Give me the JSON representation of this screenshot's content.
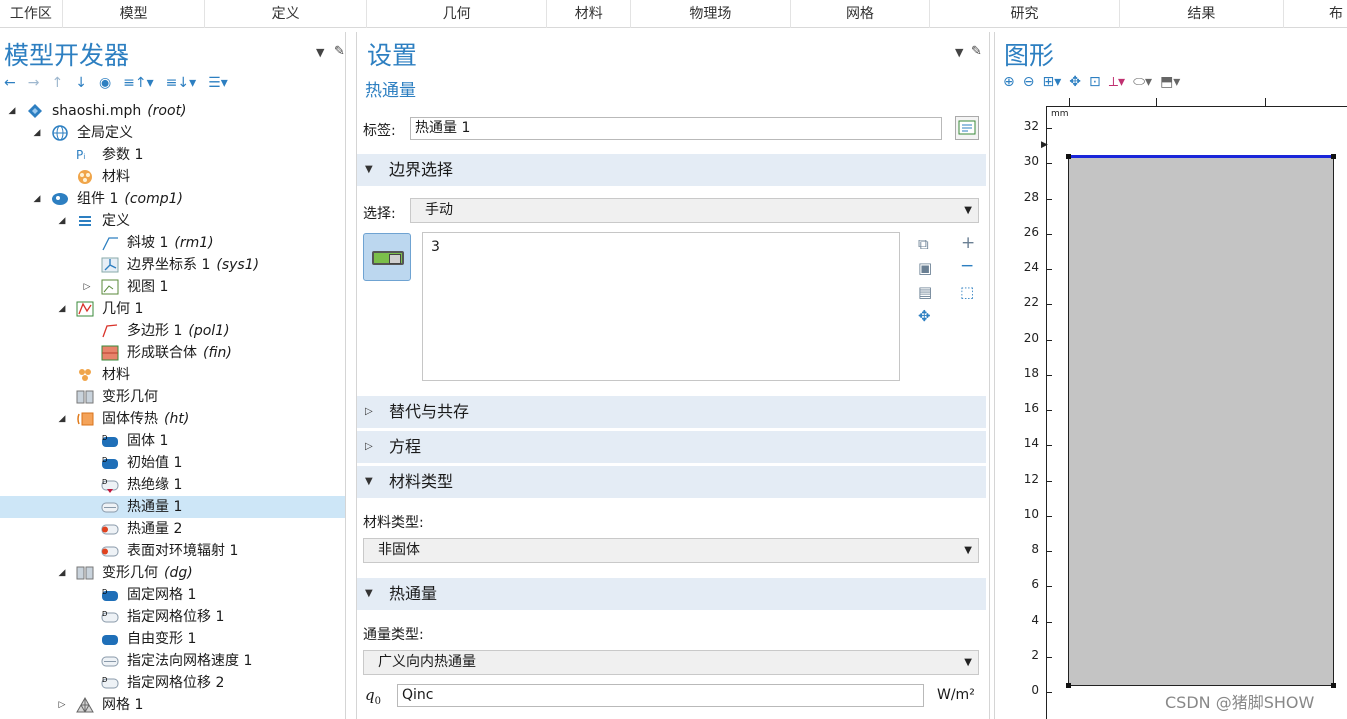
{
  "ribbon": {
    "tabs": [
      "工作区",
      "模型",
      "定义",
      "几何",
      "材料",
      "物理场",
      "网格",
      "研究",
      "结果",
      "布"
    ]
  },
  "left": {
    "title": "模型开发器",
    "toolbar": [
      "←",
      "→",
      "↑",
      "↓",
      "◉",
      "≡↑▾",
      "≡↓▾",
      "☰▾"
    ],
    "tree": [
      {
        "label": "shaoshi.mph",
        "tag": "(root)",
        "icon": "model-icon"
      },
      {
        "label": "全局定义",
        "tag": "",
        "icon": "globe-icon"
      },
      {
        "label": "参数 1",
        "tag": "",
        "icon": "parameter-icon"
      },
      {
        "label": "材料",
        "tag": "",
        "icon": "materials-icon"
      },
      {
        "label": "组件 1",
        "tag": "(comp1)",
        "icon": "component-icon"
      },
      {
        "label": "定义",
        "tag": "",
        "icon": "definitions-icon"
      },
      {
        "label": "斜坡 1",
        "tag": "(rm1)",
        "icon": "ramp-icon"
      },
      {
        "label": "边界坐标系 1",
        "tag": "(sys1)",
        "icon": "coordinate-system-icon"
      },
      {
        "label": "视图 1",
        "tag": "",
        "icon": "view-icon"
      },
      {
        "label": "几何 1",
        "tag": "",
        "icon": "geometry-icon"
      },
      {
        "label": "多边形 1",
        "tag": "(pol1)",
        "icon": "polygon-icon"
      },
      {
        "label": "形成联合体",
        "tag": "(fin)",
        "icon": "form-union-icon"
      },
      {
        "label": "材料",
        "tag": "",
        "icon": "materials-icon"
      },
      {
        "label": "变形几何",
        "tag": "",
        "icon": "deformed-geometry-icon"
      },
      {
        "label": "固体传热",
        "tag": "(ht)",
        "icon": "heat-transfer-icon"
      },
      {
        "label": "固体 1",
        "tag": "",
        "icon": "domain-feature-icon"
      },
      {
        "label": "初始值 1",
        "tag": "",
        "icon": "domain-feature-icon"
      },
      {
        "label": "热绝缘 1",
        "tag": "",
        "icon": "boundary-feature-icon"
      },
      {
        "label": "热通量 1",
        "tag": "",
        "icon": "boundary-feature-icon"
      },
      {
        "label": "热通量 2",
        "tag": "",
        "icon": "boundary-feature-icon"
      },
      {
        "label": "表面对环境辐射 1",
        "tag": "",
        "icon": "boundary-feature-icon"
      },
      {
        "label": "变形几何",
        "tag": "(dg)",
        "icon": "deformed-geometry-icon"
      },
      {
        "label": "固定网格 1",
        "tag": "",
        "icon": "domain-feature-icon"
      },
      {
        "label": "指定网格位移 1",
        "tag": "",
        "icon": "boundary-feature-icon"
      },
      {
        "label": "自由变形 1",
        "tag": "",
        "icon": "domain-feature-icon"
      },
      {
        "label": "指定法向网格速度 1",
        "tag": "",
        "icon": "boundary-feature-icon"
      },
      {
        "label": "指定网格位移 2",
        "tag": "",
        "icon": "boundary-feature-icon"
      },
      {
        "label": "网格 1",
        "tag": "",
        "icon": "mesh-icon"
      }
    ]
  },
  "settings": {
    "title": "设置",
    "subtitle": "热通量",
    "label_caption": "标签:",
    "label_value": "热通量 1",
    "sections": {
      "boundary": "边界选择",
      "override": "替代与共存",
      "equation": "方程",
      "material_type": "材料类型",
      "heat_flux": "热通量"
    },
    "selection_caption": "选择:",
    "selection_value": "手动",
    "selection_list": [
      "3"
    ],
    "material_type_caption": "材料类型:",
    "material_type_value": "非固体",
    "flux_type_caption": "通量类型:",
    "flux_type_value": "广义向内热通量",
    "q0_symbol": "q",
    "q0_sub": "0",
    "q0_value": "Qinc",
    "q0_unit": "W/m²"
  },
  "graphics": {
    "title": "图形",
    "unit": "mm",
    "yticks": [
      "32",
      "30",
      "28",
      "26",
      "24",
      "22",
      "20",
      "18",
      "16",
      "14",
      "12",
      "10",
      "8",
      "6",
      "4",
      "2",
      "0"
    ],
    "selected_boundary_color": "#1a26d9",
    "domain_color": "#c4c4c4"
  },
  "watermark": "CSDN @猪脚SHOW"
}
